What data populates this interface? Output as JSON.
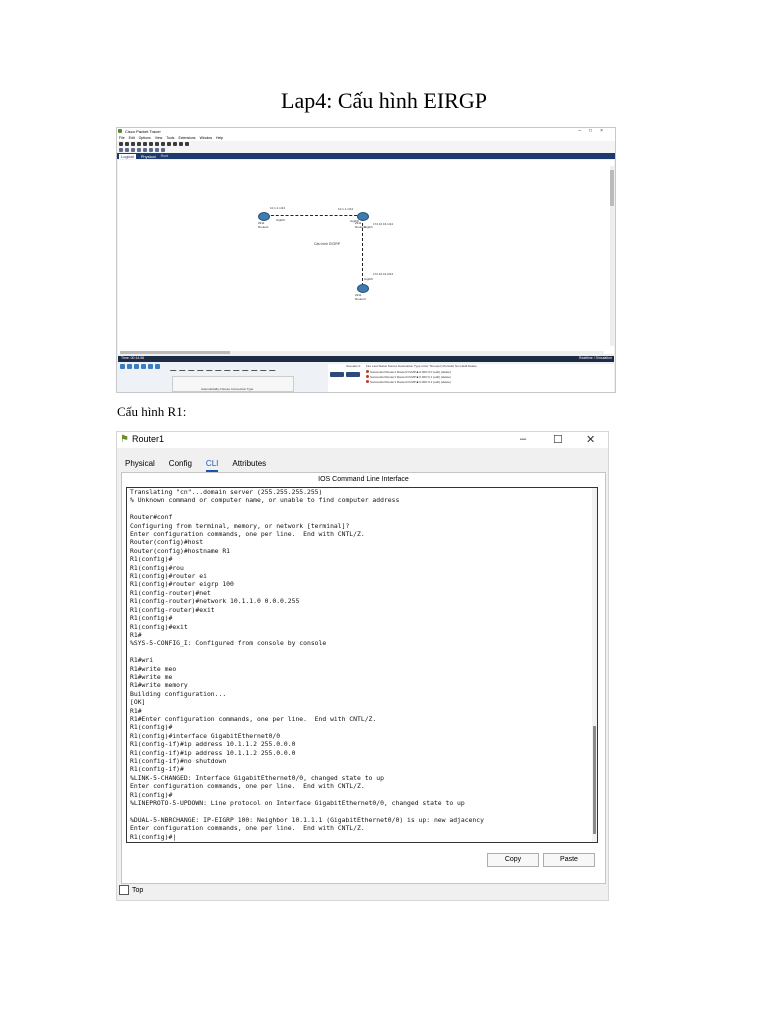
{
  "document": {
    "title": "Lap4: Cấu hình EIRGP",
    "section_label": "Cấu hình R1:"
  },
  "packet_tracer": {
    "title": "Cisco Packet Tracer",
    "menu": [
      "File",
      "Edit",
      "Options",
      "View",
      "Tools",
      "Extensions",
      "Window",
      "Help"
    ],
    "tabs": {
      "logical": "Logical",
      "physical": "Physical"
    },
    "root_label": "Root",
    "labels": {
      "r1_ip": "10.1.1.1/24",
      "r2_ip": "10.1.1.1/24",
      "r2_ip2": "172.16.16.1/24",
      "r3_ip": "172.16.16.2/24",
      "r1_name": "2911 Router1",
      "r2_name": "2911 Router2",
      "r3_name": "2911 Router3",
      "r1_port": "Gig0/0",
      "r2_port_a": "Gig0/0",
      "r2_port_b": "Gig0/1",
      "r3_port": "Gig0/0",
      "center_note": "Cấu hình EIGRP"
    },
    "status_bar": {
      "time": "Time: 00:14:56",
      "realtime": "Realtime",
      "simulation": "Simulation"
    },
    "cable_caption": "Automatically Choose Connection Type",
    "scenario": "Scenario 0",
    "pdu_headers": "Fire   Last Status   Source   Destination   Type   Color   Time(sec)   Periodic   Num   Edit   Delete",
    "pdu_rows": [
      "Successful   Router1   Router2   ICMP   ■   0.000   N   0   (edit)   (delete)",
      "Successful   Router1   Router3   ICMP   ■   0.000   N   1   (edit)   (delete)",
      "Successful   Router1   Router3   ICMP   ■   0.000   N   2   (edit)   (delete)"
    ],
    "pdu_buttons": [
      "New",
      "Delete",
      "Toggle PDU List Window"
    ]
  },
  "router_window": {
    "title": "Router1",
    "tabs": [
      "Physical",
      "Config",
      "CLI",
      "Attributes"
    ],
    "active_tab": "CLI",
    "panel_caption": "IOS Command Line Interface",
    "terminal_lines": [
      "Translating \"cn\"...domain server (255.255.255.255)",
      "% Unknown command or computer name, or unable to find computer address",
      "",
      "Router#conf",
      "Configuring from terminal, memory, or network [terminal]?",
      "Enter configuration commands, one per line.  End with CNTL/Z.",
      "Router(config)#host",
      "Router(config)#hostname R1",
      "R1(config)#",
      "R1(config)#rou",
      "R1(config)#router ei",
      "R1(config)#router eigrp 100",
      "R1(config-router)#net",
      "R1(config-router)#network 10.1.1.0 0.0.0.255",
      "R1(config-router)#exit",
      "R1(config)#",
      "R1(config)#exit",
      "R1#",
      "%SYS-5-CONFIG_I: Configured from console by console",
      "",
      "R1#wri",
      "R1#write meo",
      "R1#write me",
      "R1#write memory",
      "Building configuration...",
      "[OK]",
      "R1#",
      "R1#Enter configuration commands, one per line.  End with CNTL/Z.",
      "R1(config)#",
      "R1(config)#interface GigabitEthernet0/0",
      "R1(config-if)#ip address 10.1.1.2 255.0.0.0",
      "R1(config-if)#ip address 10.1.1.2 255.0.0.0",
      "R1(config-if)#no shutdown",
      "R1(config-if)#",
      "%LINK-5-CHANGED: Interface GigabitEthernet0/0, changed state to up",
      "Enter configuration commands, one per line.  End with CNTL/Z.",
      "R1(config)#",
      "%LINEPROTO-5-UPDOWN: Line protocol on Interface GigabitEthernet0/0, changed state to up",
      "",
      "%DUAL-5-NBRCHANGE: IP-EIGRP 100: Neighbor 10.1.1.1 (GigabitEthernet0/0) is up: new adjacency",
      "Enter configuration commands, one per line.  End with CNTL/Z.",
      "R1(config)#|"
    ],
    "buttons": {
      "copy": "Copy",
      "paste": "Paste"
    },
    "top_checkbox": "Top"
  }
}
